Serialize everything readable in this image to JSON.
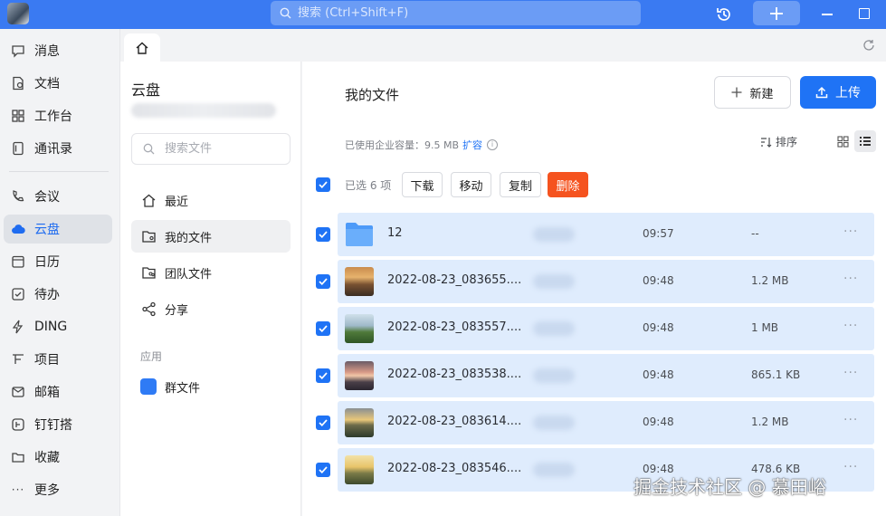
{
  "titlebar": {
    "search_placeholder": "搜索 (Ctrl+Shift+F)",
    "icons": [
      "app-logo",
      "search-icon",
      "history-icon",
      "plus-icon",
      "minimize-icon",
      "maximize-icon"
    ],
    "accent": "#3a7af2"
  },
  "nav": {
    "items": [
      {
        "label": "消息",
        "icon": "chat-bubble-icon"
      },
      {
        "label": "文档",
        "icon": "document-icon"
      },
      {
        "label": "工作台",
        "icon": "grid-icon"
      },
      {
        "label": "通讯录",
        "icon": "contacts-icon"
      },
      {
        "label": "会议",
        "icon": "phone-video-icon"
      },
      {
        "label": "云盘",
        "icon": "cloud-icon"
      },
      {
        "label": "日历",
        "icon": "calendar-icon"
      },
      {
        "label": "待办",
        "icon": "checkbox-icon"
      },
      {
        "label": "DING",
        "icon": "lightning-icon"
      },
      {
        "label": "项目",
        "icon": "project-icon"
      },
      {
        "label": "邮箱",
        "icon": "mail-icon"
      },
      {
        "label": "钉钉搭",
        "icon": "builder-icon"
      },
      {
        "label": "收藏",
        "icon": "star-folder-icon"
      },
      {
        "label": "更多",
        "icon": "more-dots-icon"
      }
    ],
    "active": "云盘"
  },
  "tabs": {
    "home_icon": "home-icon",
    "refresh_icon": "refresh-icon"
  },
  "sidebar": {
    "title": "云盘",
    "search_placeholder": "搜索文件",
    "items": [
      {
        "label": "最近",
        "icon": "clock-house-icon"
      },
      {
        "label": "我的文件",
        "icon": "my-folder-icon"
      },
      {
        "label": "团队文件",
        "icon": "team-folder-icon"
      },
      {
        "label": "分享",
        "icon": "share-icon"
      }
    ],
    "section_label": "应用",
    "app_item": {
      "label": "群文件",
      "icon": "group-file-icon"
    }
  },
  "main": {
    "title": "我的文件",
    "new_button": "新建",
    "upload_button": "上传",
    "usage_text": "已使用企业容量：9.5 MB",
    "expand_link": "扩容",
    "sort_label": "排序",
    "selected_text": "已选 6 项",
    "actions": {
      "download": "下载",
      "move": "移动",
      "copy": "复制",
      "delete": "删除"
    },
    "files": [
      {
        "name": "12",
        "time": "09:57",
        "size": "--",
        "type": "folder"
      },
      {
        "name": "2022-08-23_083655....",
        "time": "09:48",
        "size": "1.2 MB",
        "type": "image"
      },
      {
        "name": "2022-08-23_083557....",
        "time": "09:48",
        "size": "1 MB",
        "type": "image"
      },
      {
        "name": "2022-08-23_083538....",
        "time": "09:48",
        "size": "865.1 KB",
        "type": "image"
      },
      {
        "name": "2022-08-23_083614....",
        "time": "09:48",
        "size": "1.2 MB",
        "type": "image"
      },
      {
        "name": "2022-08-23_083546....",
        "time": "09:48",
        "size": "478.6 KB",
        "type": "image"
      }
    ],
    "more_glyph": "···"
  },
  "watermark": "掘金技术社区 @ 慕田峪"
}
